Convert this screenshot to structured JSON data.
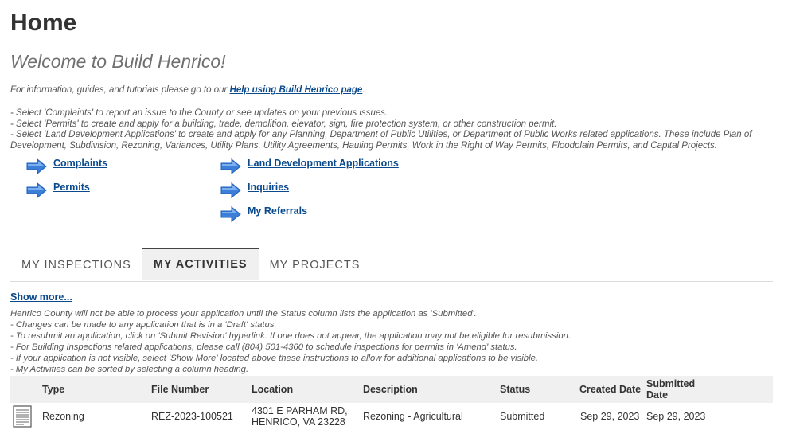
{
  "page": {
    "title": "Home",
    "welcome": "Welcome to Build Henrico!",
    "info_prefix": "For information, guides, and tutorials please go to our ",
    "info_link": "Help using Build Henrico page",
    "info_suffix": "."
  },
  "instructions": [
    "- Select 'Complaints' to report an issue to the County or see updates on your previous issues.",
    "- Select 'Permits' to create and apply for a building, trade, demolition, elevator, sign, fire protection system, or other construction permit.",
    "- Select 'Land Development Applications' to create and apply for any Planning, Department of Public Utilities, or Department of Public Works related applications. These include Plan of Development, Subdivision, Rezoning, Variances, Utility Plans, Utility Agreements, Hauling Permits, Work in the Right of Way Permits, Floodplain Permits, and Capital Projects."
  ],
  "quick_links": {
    "complaints": "Complaints",
    "permits": "Permits",
    "land_development": "Land Development Applications",
    "inquiries": "Inquiries",
    "my_referrals": "My Referrals"
  },
  "tabs": {
    "inspections": "MY INSPECTIONS",
    "activities": "MY ACTIVITIES",
    "projects": "MY PROJECTS",
    "active": "activities"
  },
  "activities": {
    "show_more": "Show more...",
    "notes": [
      "Henrico County will not be able to process your application until the Status column lists the application as 'Submitted'.",
      "- Changes can be made to any application that is in a 'Draft' status.",
      "- To resubmit an application, click on 'Submit Revision' hyperlink. If one does not appear, the application may not be eligible for resubmission.",
      "- For Building Inspections related applications, please call (804) 501-4360 to schedule inspections for permits in 'Amend' status.",
      "- If your application is not visible, select 'Show More' located above these instructions to allow for additional applications to be visible.",
      "- My Activities can be sorted by selecting a column heading."
    ],
    "columns": {
      "type": "Type",
      "file_number": "File Number",
      "location": "Location",
      "description": "Description",
      "status": "Status",
      "created_date": "Created Date",
      "submitted_date": "Submitted Date"
    },
    "rows": [
      {
        "icon": "document-icon",
        "type": "Rezoning",
        "file_number": "REZ-2023-100521",
        "location": "4301 E PARHAM RD, HENRICO, VA 23228",
        "description": "Rezoning - Agricultural",
        "status": "Submitted",
        "created_date": "Sep 29, 2023",
        "submitted_date": "Sep 29, 2023"
      }
    ]
  },
  "colors": {
    "link": "#0a4a8c",
    "arrow": "#3b7fd9",
    "tab_active_bg": "#f0f0f0",
    "table_header_bg": "#f0f0f0"
  }
}
